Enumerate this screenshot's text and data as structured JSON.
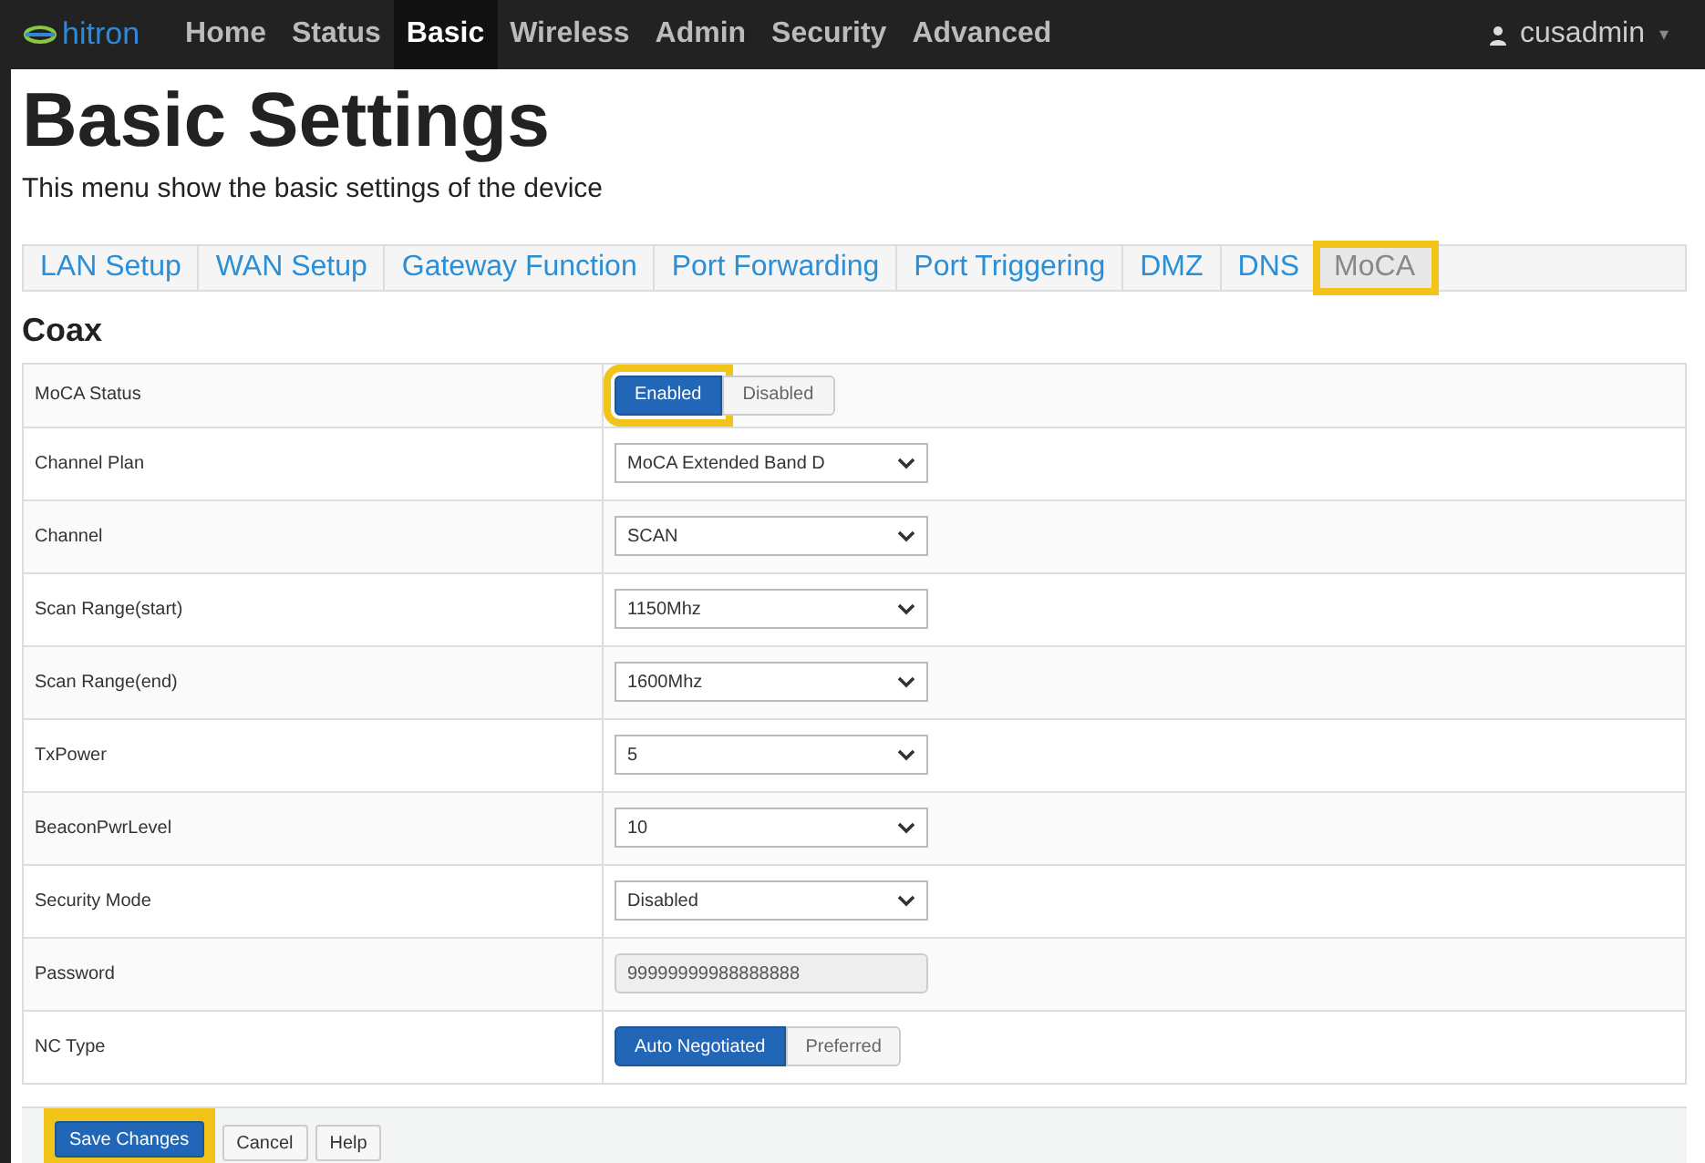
{
  "nav": {
    "logo": "hitron",
    "items": [
      {
        "label": "Home",
        "selected": false
      },
      {
        "label": "Status",
        "selected": false
      },
      {
        "label": "Basic",
        "selected": true
      },
      {
        "label": "Wireless",
        "selected": false
      },
      {
        "label": "Admin",
        "selected": false
      },
      {
        "label": "Security",
        "selected": false
      },
      {
        "label": "Advanced",
        "selected": false
      }
    ],
    "user": "cusadmin",
    "user_caret": "▾"
  },
  "page": {
    "title": "Basic Settings",
    "subtitle": "This menu show the basic settings of the device"
  },
  "tabs": [
    {
      "label": "LAN Setup",
      "selected": false,
      "highlighted": false
    },
    {
      "label": "WAN Setup",
      "selected": false,
      "highlighted": false
    },
    {
      "label": "Gateway Function",
      "selected": false,
      "highlighted": false
    },
    {
      "label": "Port Forwarding",
      "selected": false,
      "highlighted": false
    },
    {
      "label": "Port Triggering",
      "selected": false,
      "highlighted": false
    },
    {
      "label": "DMZ",
      "selected": false,
      "highlighted": false
    },
    {
      "label": "DNS",
      "selected": false,
      "highlighted": false
    },
    {
      "label": "MoCA",
      "selected": true,
      "highlighted": true
    }
  ],
  "section": "Coax",
  "rows": [
    {
      "label": "MoCA Status",
      "kind": "toggle",
      "options": [
        {
          "label": "Enabled",
          "selected": true,
          "highlighted": true
        },
        {
          "label": "Disabled",
          "selected": false,
          "highlighted": false
        }
      ]
    },
    {
      "label": "Channel Plan",
      "kind": "select",
      "value": "MoCA Extended Band D"
    },
    {
      "label": "Channel",
      "kind": "select",
      "value": "SCAN"
    },
    {
      "label": "Scan Range(start)",
      "kind": "select",
      "value": "1150Mhz"
    },
    {
      "label": "Scan Range(end)",
      "kind": "select",
      "value": "1600Mhz"
    },
    {
      "label": "TxPower",
      "kind": "select",
      "value": "5"
    },
    {
      "label": "BeaconPwrLevel",
      "kind": "select",
      "value": "10"
    },
    {
      "label": "Security Mode",
      "kind": "select",
      "value": "Disabled"
    },
    {
      "label": "Password",
      "kind": "text",
      "value": "99999999988888888",
      "disabled": true
    },
    {
      "label": "NC Type",
      "kind": "toggle",
      "options": [
        {
          "label": "Auto Negotiated",
          "selected": true,
          "highlighted": false
        },
        {
          "label": "Preferred",
          "selected": false,
          "highlighted": false
        }
      ]
    }
  ],
  "buttons": [
    {
      "label": "Save Changes",
      "kind": "primary",
      "highlighted": true
    },
    {
      "label": "Cancel",
      "kind": "default",
      "highlighted": false
    },
    {
      "label": "Help",
      "kind": "default",
      "highlighted": false
    }
  ]
}
